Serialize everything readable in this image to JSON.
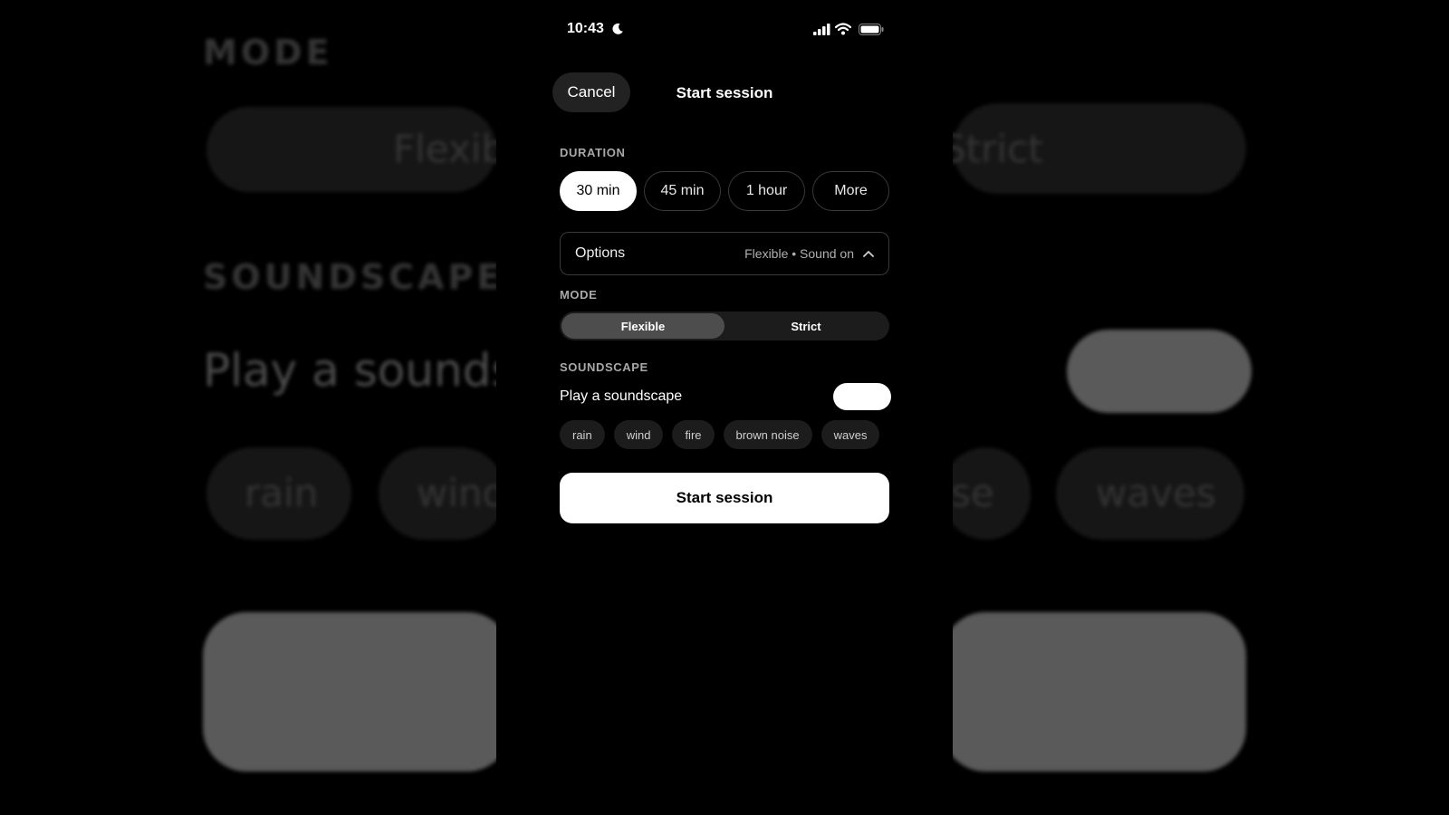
{
  "status_bar": {
    "time": "10:43"
  },
  "header": {
    "cancel_label": "Cancel",
    "title": "Start session"
  },
  "duration": {
    "label": "DURATION",
    "options": [
      "30 min",
      "45 min",
      "1 hour",
      "More"
    ],
    "selected": "30 min"
  },
  "options": {
    "label": "Options",
    "summary": "Flexible • Sound on"
  },
  "mode": {
    "label": "MODE",
    "options": [
      "Flexible",
      "Strict"
    ],
    "selected": "Flexible"
  },
  "soundscape": {
    "label": "SOUNDSCAPE",
    "toggle_label": "Play a soundscape",
    "toggle_on": true,
    "sounds": [
      "rain",
      "wind",
      "fire",
      "brown noise",
      "waves"
    ]
  },
  "start_button": {
    "label": "Start session"
  },
  "background": {
    "mode_heading": "MODE",
    "mode_flexible": "Flexib",
    "mode_strict": "Strict",
    "soundscape_heading": "SOUNDSCAPE",
    "soundscape_text": "Play a sounds",
    "chip_rain": "rain",
    "chip_wind": "wind",
    "chip_se": "se",
    "chip_waves": "waves"
  },
  "colors": {
    "background": "#000000",
    "accent": "#ffffff",
    "surface": "#1c1c1c",
    "segment_active": "#4d4d4d"
  }
}
